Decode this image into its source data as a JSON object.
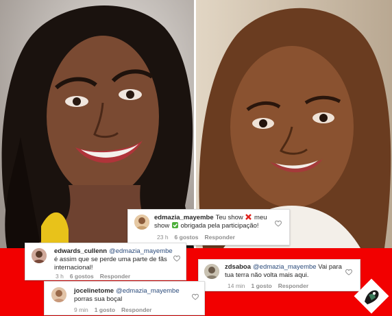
{
  "comments": [
    {
      "username": "edmazia_mayembe",
      "text_before_x": "Teu show",
      "text_after_x": "meu show",
      "text_after_check": "obrigada pela participação!",
      "time": "23 h",
      "likes": "6 gostos",
      "reply": "Responder"
    },
    {
      "username": "edwards_cullenn",
      "mention": "@edmazia_mayembe",
      "text": "é assim que se perde uma parte de fãs internacional!",
      "time": "3 h",
      "likes": "6 gostos",
      "reply": "Responder"
    },
    {
      "username": "zdsaboa",
      "mention": "@edmazia_mayembe",
      "text": "Vai para tua terra não volta mais aqui.",
      "time": "14 min",
      "likes": "1 gosto",
      "reply": "Responder"
    },
    {
      "username": "jocelinetome",
      "mention": "@edmazia_mayembe",
      "text": "porras sua boçal",
      "time": "9 min",
      "likes": "1 gosto",
      "reply": "Responder"
    }
  ],
  "icons": {
    "like": "heart-outline-icon",
    "cross": "red-cross-mark-icon",
    "check": "green-check-mark-icon"
  },
  "colors": {
    "background_band": "#f20000",
    "mention": "#2a4a7a",
    "meta": "#8e8e8e"
  }
}
